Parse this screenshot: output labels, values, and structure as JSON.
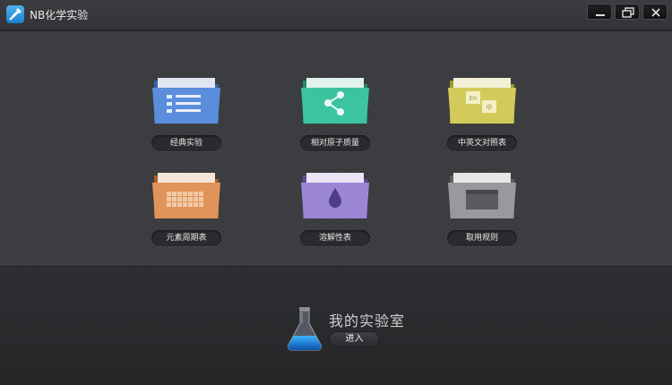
{
  "window": {
    "title": "NB化学实验",
    "accent": "#2a8fe0",
    "controls": {
      "minimize_icon": "minimize-icon",
      "restore_icon": "restore-icon",
      "close_icon": "close-icon"
    }
  },
  "tiles": [
    {
      "label": "经典实验",
      "color": "#4a7fd0",
      "icon": "list-icon"
    },
    {
      "label": "相对原子质量",
      "color": "#2fae8a",
      "icon": "molecule-icon"
    },
    {
      "label": "中英文对照表",
      "color": "#c7c046",
      "icon": "translate-icon"
    },
    {
      "label": "元素周期表",
      "color": "#d98a46",
      "icon": "grid-chart-icon"
    },
    {
      "label": "溶解性表",
      "color": "#8f78c9",
      "icon": "droplet-icon"
    },
    {
      "label": "取用规则",
      "color": "#8b8c8e",
      "icon": "window-icon"
    }
  ],
  "lab": {
    "title": "我的实验室",
    "enter_label": "进入",
    "icon": "flask-icon"
  }
}
